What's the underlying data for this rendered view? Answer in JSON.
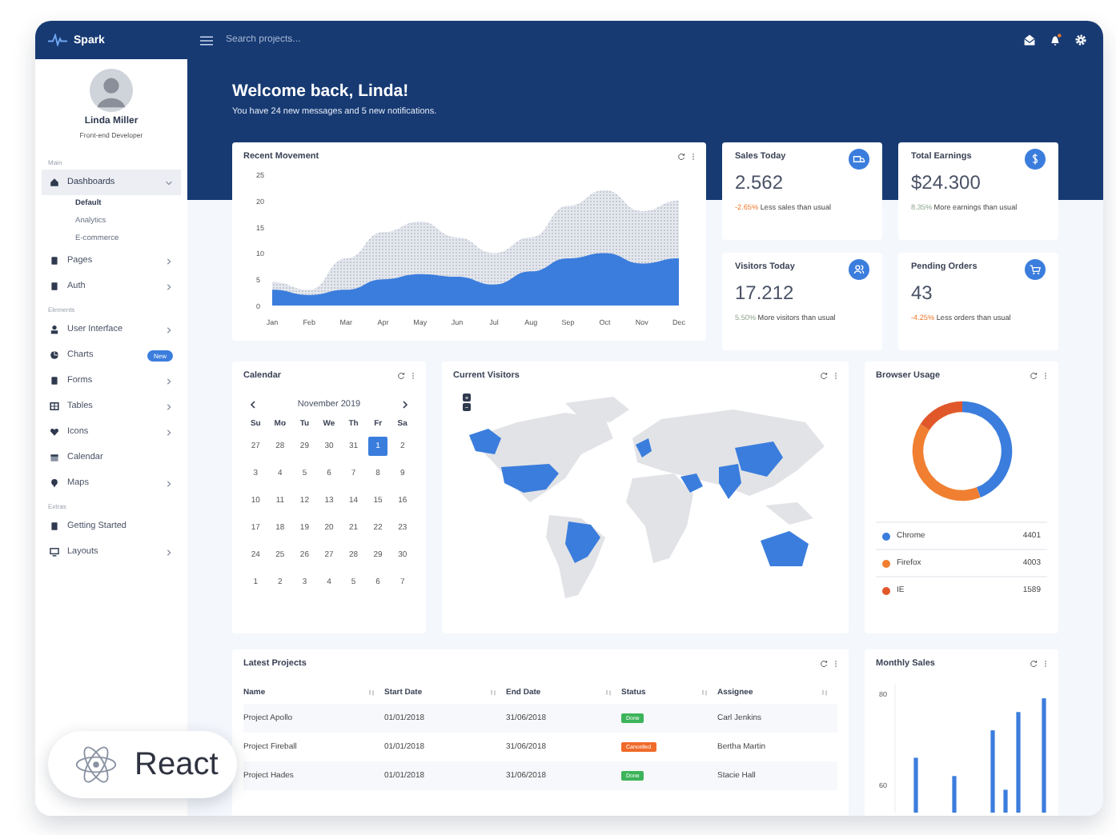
{
  "topbar": {
    "brand": "Spark",
    "search": {
      "placeholder": "Search projects..."
    },
    "notifications": {
      "unread": true
    }
  },
  "sidebar": {
    "user": {
      "name": "Linda Miller",
      "role": "Front-end Developer"
    },
    "sections": [
      {
        "heading": "Main",
        "items": [
          {
            "label": "Dashboards",
            "selected": true,
            "expanded": true,
            "children": [
              {
                "label": "Default",
                "selected": true
              },
              {
                "label": "Analytics",
                "selected": false
              },
              {
                "label": "E-commerce",
                "selected": false
              }
            ]
          },
          {
            "label": "Pages",
            "selected": false,
            "expanded": false
          },
          {
            "label": "Auth",
            "selected": false,
            "expanded": false
          }
        ]
      },
      {
        "heading": "Elements",
        "items": [
          {
            "label": "User Interface",
            "selected": false,
            "expanded": false
          },
          {
            "label": "Charts",
            "selected": false,
            "badge": "New"
          },
          {
            "label": "Forms",
            "selected": false,
            "expanded": false
          },
          {
            "label": "Tables",
            "selected": false,
            "expanded": false
          },
          {
            "label": "Icons",
            "selected": false,
            "expanded": false
          },
          {
            "label": "Calendar",
            "selected": false
          },
          {
            "label": "Maps",
            "selected": false,
            "expanded": false
          }
        ]
      },
      {
        "heading": "Extras",
        "items": [
          {
            "label": "Getting Started",
            "selected": false
          },
          {
            "label": "Layouts",
            "selected": false,
            "expanded": false
          }
        ]
      }
    ]
  },
  "header": {
    "title": "Welcome back, Linda!",
    "subtitle": "You have 24 new messages and 5 new notifications."
  },
  "recent_movement": {
    "title": "Recent Movement",
    "chart_data": {
      "type": "area",
      "categories": [
        "Jan",
        "Feb",
        "Mar",
        "Apr",
        "May",
        "Jun",
        "Jul",
        "Aug",
        "Sep",
        "Oct",
        "Nov",
        "Dec"
      ],
      "ylim": [
        0,
        25
      ],
      "yticks": [
        0,
        5,
        10,
        15,
        20,
        25
      ],
      "series": [
        {
          "color": "#e4e7ee",
          "values": [
            4.5,
            3,
            9,
            14,
            16,
            13,
            10,
            13,
            19,
            22,
            18,
            20
          ]
        },
        {
          "color": "#3b7ddd",
          "values": [
            3,
            2,
            3,
            5,
            6,
            5.5,
            4,
            6.5,
            9,
            10,
            8,
            9
          ]
        }
      ]
    }
  },
  "stats": [
    {
      "title": "Sales Today",
      "value": "2.562",
      "change": "-2.65%",
      "negative": true,
      "note": "Less sales than usual"
    },
    {
      "title": "Total Earnings",
      "value": "$24.300",
      "change": "8.35%",
      "negative": false,
      "note": "More earnings than usual"
    },
    {
      "title": "Visitors Today",
      "value": "17.212",
      "change": "5.50%",
      "negative": false,
      "note": "More visitors than usual"
    },
    {
      "title": "Pending Orders",
      "value": "43",
      "change": "-4.25%",
      "negative": true,
      "note": "Less orders than usual"
    }
  ],
  "calendar": {
    "title": "Calendar",
    "month": "November 2019",
    "weekdays": [
      "Su",
      "Mo",
      "Tu",
      "We",
      "Th",
      "Fr",
      "Sa"
    ],
    "weeks": [
      [
        {
          "day": "27",
          "selected": false
        },
        {
          "day": "28",
          "selected": false
        },
        {
          "day": "29",
          "selected": false
        },
        {
          "day": "30",
          "selected": false
        },
        {
          "day": "31",
          "selected": false
        },
        {
          "day": "1",
          "selected": true
        },
        {
          "day": "2",
          "selected": false
        }
      ],
      [
        {
          "day": "3",
          "selected": false
        },
        {
          "day": "4",
          "selected": false
        },
        {
          "day": "5",
          "selected": false
        },
        {
          "day": "6",
          "selected": false
        },
        {
          "day": "7",
          "selected": false
        },
        {
          "day": "8",
          "selected": false
        },
        {
          "day": "9",
          "selected": false
        }
      ],
      [
        {
          "day": "10",
          "selected": false
        },
        {
          "day": "11",
          "selected": false
        },
        {
          "day": "12",
          "selected": false
        },
        {
          "day": "13",
          "selected": false
        },
        {
          "day": "14",
          "selected": false
        },
        {
          "day": "15",
          "selected": false
        },
        {
          "day": "16",
          "selected": false
        }
      ],
      [
        {
          "day": "17",
          "selected": false
        },
        {
          "day": "18",
          "selected": false
        },
        {
          "day": "19",
          "selected": false
        },
        {
          "day": "20",
          "selected": false
        },
        {
          "day": "21",
          "selected": false
        },
        {
          "day": "22",
          "selected": false
        },
        {
          "day": "23",
          "selected": false
        }
      ],
      [
        {
          "day": "24",
          "selected": false
        },
        {
          "day": "25",
          "selected": false
        },
        {
          "day": "26",
          "selected": false
        },
        {
          "day": "27",
          "selected": false
        },
        {
          "day": "28",
          "selected": false
        },
        {
          "day": "29",
          "selected": false
        },
        {
          "day": "30",
          "selected": false
        }
      ],
      [
        {
          "day": "1",
          "selected": false
        },
        {
          "day": "2",
          "selected": false
        },
        {
          "day": "3",
          "selected": false
        },
        {
          "day": "4",
          "selected": false
        },
        {
          "day": "5",
          "selected": false
        },
        {
          "day": "6",
          "selected": false
        },
        {
          "day": "7",
          "selected": false
        }
      ]
    ]
  },
  "current_visitors": {
    "title": "Current Visitors",
    "zoom_controls": [
      "+",
      "−"
    ]
  },
  "browser_usage": {
    "title": "Browser Usage",
    "chart_data": {
      "type": "donut",
      "values": [
        44.04,
        40.06,
        15.9
      ]
    },
    "legend": [
      {
        "label": "Chrome",
        "value": "4401",
        "color": "#3b7ddd"
      },
      {
        "label": "Firefox",
        "value": "4003",
        "color": "#f07f31"
      },
      {
        "label": "IE",
        "value": "1589",
        "color": "#e0582a"
      }
    ]
  },
  "latest_projects": {
    "title": "Latest Projects",
    "columns": [
      "Name",
      "Start Date",
      "End Date",
      "Status",
      "Assignee"
    ],
    "rows": [
      {
        "name": "Project Apollo",
        "start": "01/01/2018",
        "end": "31/06/2018",
        "status": {
          "label": "Done",
          "color": "#3cb45a"
        },
        "assignee": "Carl Jenkins"
      },
      {
        "name": "Project Fireball",
        "start": "01/01/2018",
        "end": "31/06/2018",
        "status": {
          "label": "Cancelled",
          "color": "#f06a2a"
        },
        "assignee": "Bertha Martin"
      },
      {
        "name": "Project Hades",
        "start": "01/01/2018",
        "end": "31/06/2018",
        "status": {
          "label": "Done",
          "color": "#3cb45a"
        },
        "assignee": "Stacie Hall"
      }
    ]
  },
  "monthly_sales": {
    "title": "Monthly Sales",
    "axis_labels": [
      "80",
      "60"
    ]
  },
  "badge": {
    "label": "React"
  }
}
